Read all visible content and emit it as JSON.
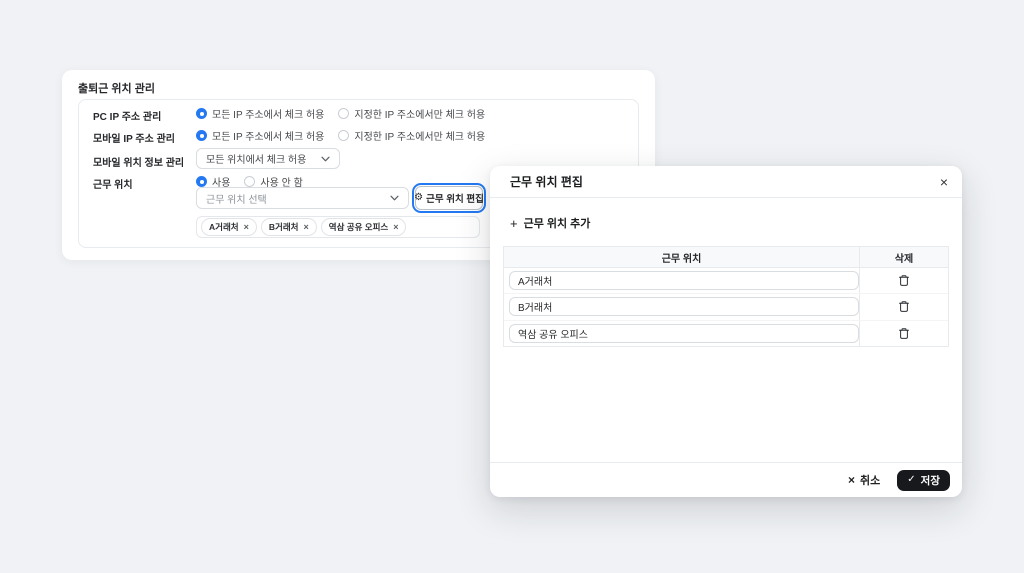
{
  "icons": {
    "gear": "⚙",
    "plus": "+",
    "close": "×",
    "cancel_x": "×",
    "check": "✓",
    "remove": "×"
  },
  "colors": {
    "accent_blue": "#2479f2",
    "save_button_bg": "#17191c",
    "page_bg": "#f0f2f5"
  },
  "settings_card": {
    "title": "출퇴근 위치 관리",
    "pc_ip": {
      "label": "PC IP 주소 관리",
      "options": [
        {
          "label": "모든 IP 주소에서 체크 허용",
          "selected": true
        },
        {
          "label": "지정한 IP 주소에서만 체크 허용",
          "selected": false
        }
      ]
    },
    "mobile_ip": {
      "label": "모바일 IP 주소 관리",
      "options": [
        {
          "label": "모든 IP 주소에서 체크 허용",
          "selected": true
        },
        {
          "label": "지정한 IP 주소에서만 체크 허용",
          "selected": false
        }
      ]
    },
    "mobile_location": {
      "label": "모바일 위치 정보 관리",
      "value": "모든 위치에서 체크 허용"
    },
    "work_location": {
      "label": "근무 위치",
      "options": [
        {
          "label": "사용",
          "selected": true
        },
        {
          "label": "사용 안 함",
          "selected": false
        }
      ],
      "select_placeholder": "근무 위치 선택",
      "edit_button_label": "근무 위치 편집",
      "tags": [
        {
          "label": "A거래처"
        },
        {
          "label": "B거래처"
        },
        {
          "label": "역삼 공유 오피스"
        }
      ]
    }
  },
  "modal": {
    "title": "근무 위치 편집",
    "add_button_label": "근무 위치 추가",
    "table": {
      "headers": [
        "근무 위치",
        "삭제"
      ],
      "rows": [
        {
          "value": "A거래처"
        },
        {
          "value": "B거래처"
        },
        {
          "value": "역삼 공유 오피스"
        }
      ]
    },
    "cancel_label": "취소",
    "save_label": "저장"
  }
}
